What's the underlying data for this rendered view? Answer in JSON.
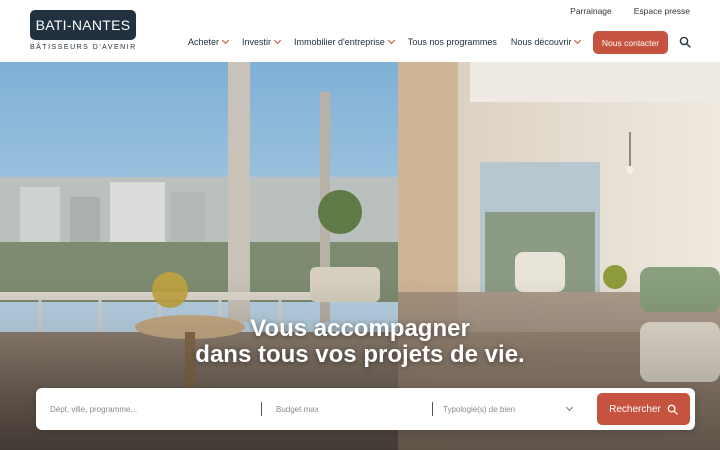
{
  "header": {
    "top_links": [
      "Parrainage",
      "Espace presse"
    ],
    "logo": {
      "name": "BATI-NANTES",
      "tagline": "BÂTISSEURS D'AVENIR"
    },
    "nav": [
      {
        "label": "Acheter",
        "has_dropdown": true
      },
      {
        "label": "Investir",
        "has_dropdown": true
      },
      {
        "label": "Immobilier d'entreprise",
        "has_dropdown": true
      },
      {
        "label": "Tous nos programmes",
        "has_dropdown": false
      },
      {
        "label": "Nous découvrir",
        "has_dropdown": true
      }
    ],
    "contact_label": "Nous contacter",
    "search_icon": "search-icon"
  },
  "hero": {
    "headline_line1": "Vous accompagner",
    "headline_line2": "dans tous vos projets de vie."
  },
  "search": {
    "location_placeholder": "Dépt, ville, programme...",
    "budget_placeholder": "Budget max",
    "type_placeholder": "Typologie(s) de bien",
    "button_label": "Rechercher"
  },
  "colors": {
    "brand_dark": "#22313f",
    "accent": "#c5533f"
  }
}
